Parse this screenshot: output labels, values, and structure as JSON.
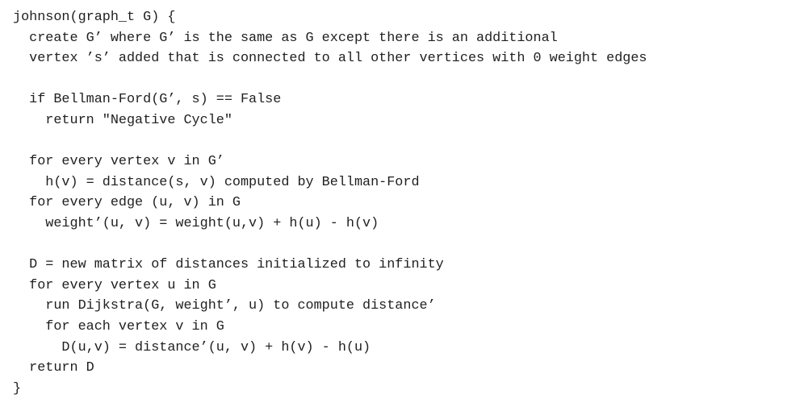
{
  "document": {
    "lines": [
      "johnson(graph_t G) {",
      "  create G’ where G’ is the same as G except there is an additional",
      "  vertex ’s’ added that is connected to all other vertices with 0 weight edges",
      "",
      "  if Bellman-Ford(G’, s) == False",
      "    return \"Negative Cycle\"",
      "",
      "  for every vertex v in G’",
      "    h(v) = distance(s, v) computed by Bellman-Ford",
      "  for every edge (u, v) in G",
      "    weight’(u, v) = weight(u,v) + h(u) - h(v)",
      "",
      "  D = new matrix of distances initialized to infinity",
      "  for every vertex u in G",
      "    run Dijkstra(G, weight’, u) to compute distance’",
      "    for each vertex v in G",
      "      D(u,v) = distance’(u, v) + h(v) - h(u)",
      "  return D",
      "}"
    ]
  }
}
